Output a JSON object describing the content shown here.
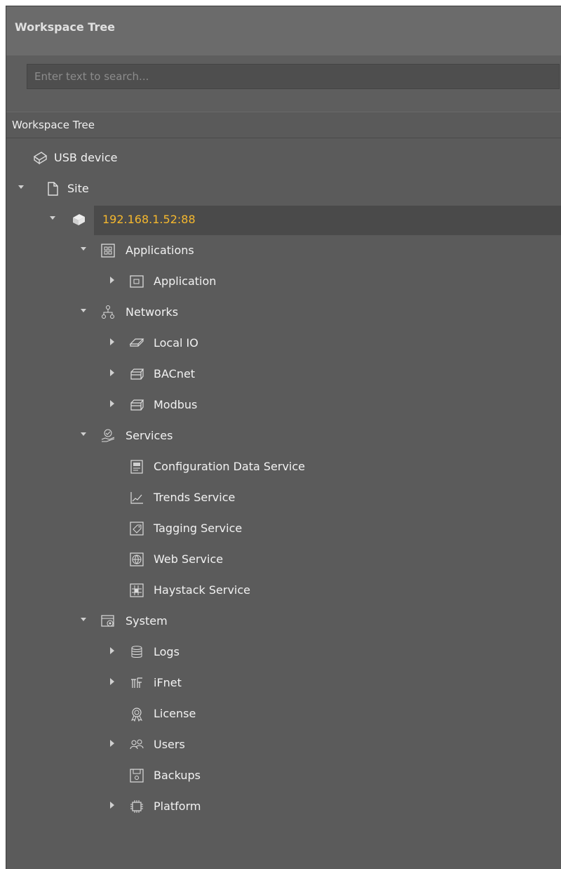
{
  "panel": {
    "title": "Workspace Tree",
    "search_placeholder": "Enter text to search...",
    "header": "Workspace Tree"
  },
  "colors": {
    "panel_bg": "#5b5b5b",
    "selected_text": "#f5b82e",
    "selected_bg": "#4a4a4a",
    "text": "#f2f2f2"
  },
  "tree": {
    "usb": {
      "label": "USB device",
      "icon": "usb-device-icon"
    },
    "site": {
      "label": "Site",
      "icon": "document-icon"
    },
    "device": {
      "label": "192.168.1.52:88",
      "icon": "device-icon"
    },
    "applications": {
      "label": "Applications",
      "icon": "applications-icon"
    },
    "application": {
      "label": "Application",
      "icon": "application-icon"
    },
    "networks": {
      "label": "Networks",
      "icon": "network-icon"
    },
    "local_io": {
      "label": "Local IO",
      "icon": "local-io-icon"
    },
    "bacnet": {
      "label": "BACnet",
      "icon": "network-card-icon"
    },
    "modbus": {
      "label": "Modbus",
      "icon": "network-card-icon"
    },
    "services": {
      "label": "Services",
      "icon": "services-icon"
    },
    "config_data_service": {
      "label": "Configuration Data Service",
      "icon": "config-data-icon"
    },
    "trends_service": {
      "label": "Trends Service",
      "icon": "trend-chart-icon"
    },
    "tagging_service": {
      "label": "Tagging Service",
      "icon": "tag-icon"
    },
    "web_service": {
      "label": "Web Service",
      "icon": "web-service-icon"
    },
    "haystack_service": {
      "label": "Haystack Service",
      "icon": "haystack-icon"
    },
    "system": {
      "label": "System",
      "icon": "system-icon"
    },
    "logs": {
      "label": "Logs",
      "icon": "database-icon"
    },
    "ifnet": {
      "label": "iFnet",
      "icon": "ifnet-icon"
    },
    "license": {
      "label": "License",
      "icon": "license-icon"
    },
    "users": {
      "label": "Users",
      "icon": "users-icon"
    },
    "backups": {
      "label": "Backups",
      "icon": "backup-icon"
    },
    "platform": {
      "label": "Platform",
      "icon": "chip-icon"
    }
  }
}
